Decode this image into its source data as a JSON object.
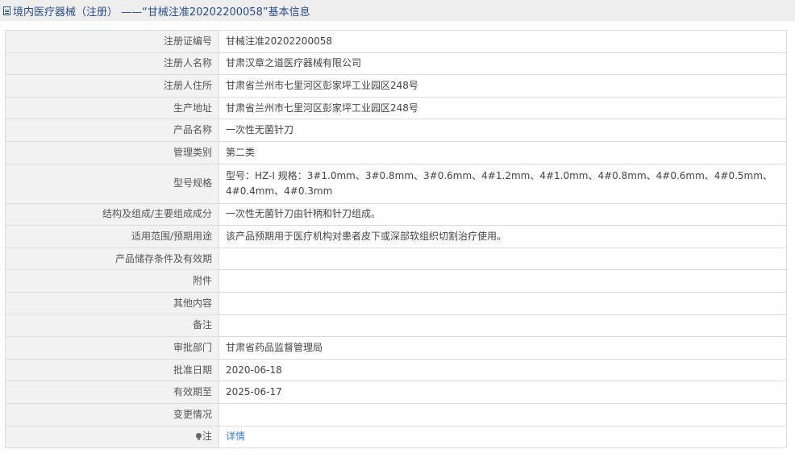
{
  "header": {
    "title": "境内医疗器械（注册） ——“甘械注准20202200058”基本信息"
  },
  "rows": [
    {
      "label": "注册证编号",
      "value": "甘械注准20202200058"
    },
    {
      "label": "注册人名称",
      "value": "甘肃汉章之道医疗器械有限公司"
    },
    {
      "label": "注册人住所",
      "value": "甘肃省兰州市七里河区彭家坪工业园区248号"
    },
    {
      "label": "生产地址",
      "value": "甘肃省兰州市七里河区彭家坪工业园区248号"
    },
    {
      "label": "产品名称",
      "value": "一次性无菌针刀"
    },
    {
      "label": "管理类别",
      "value": "第二类"
    },
    {
      "label": "型号规格",
      "value": "型号：HZ-Ⅰ 规格：3#1.0mm、3#0.8mm、3#0.6mm、4#1.2mm、4#1.0mm、4#0.8mm、4#0.6mm、4#0.5mm、4#0.4mm、4#0.3mm"
    },
    {
      "label": "结构及组成/主要组成成分",
      "value": "一次性无菌针刀由针柄和针刀组成。"
    },
    {
      "label": "适用范围/预期用途",
      "value": "该产品预期用于医疗机构对患者皮下或深部软组织切割治疗使用。"
    },
    {
      "label": "产品储存条件及有效期",
      "value": ""
    },
    {
      "label": "附件",
      "value": ""
    },
    {
      "label": "其他内容",
      "value": ""
    },
    {
      "label": "备注",
      "value": ""
    },
    {
      "label": "审批部门",
      "value": "甘肃省药品监督管理局"
    },
    {
      "label": "批准日期",
      "value": "2020-06-18"
    },
    {
      "label": "有效期至",
      "value": "2025-06-17"
    },
    {
      "label": "变更情况",
      "value": ""
    }
  ],
  "note": {
    "label": "注",
    "icon": "lightbulb-icon",
    "link": "详情"
  },
  "colors": {
    "title": "#2a4d8c",
    "link": "#3b7fd6",
    "label_bg": "#f2f2f2",
    "border": "#dcdcdc"
  }
}
